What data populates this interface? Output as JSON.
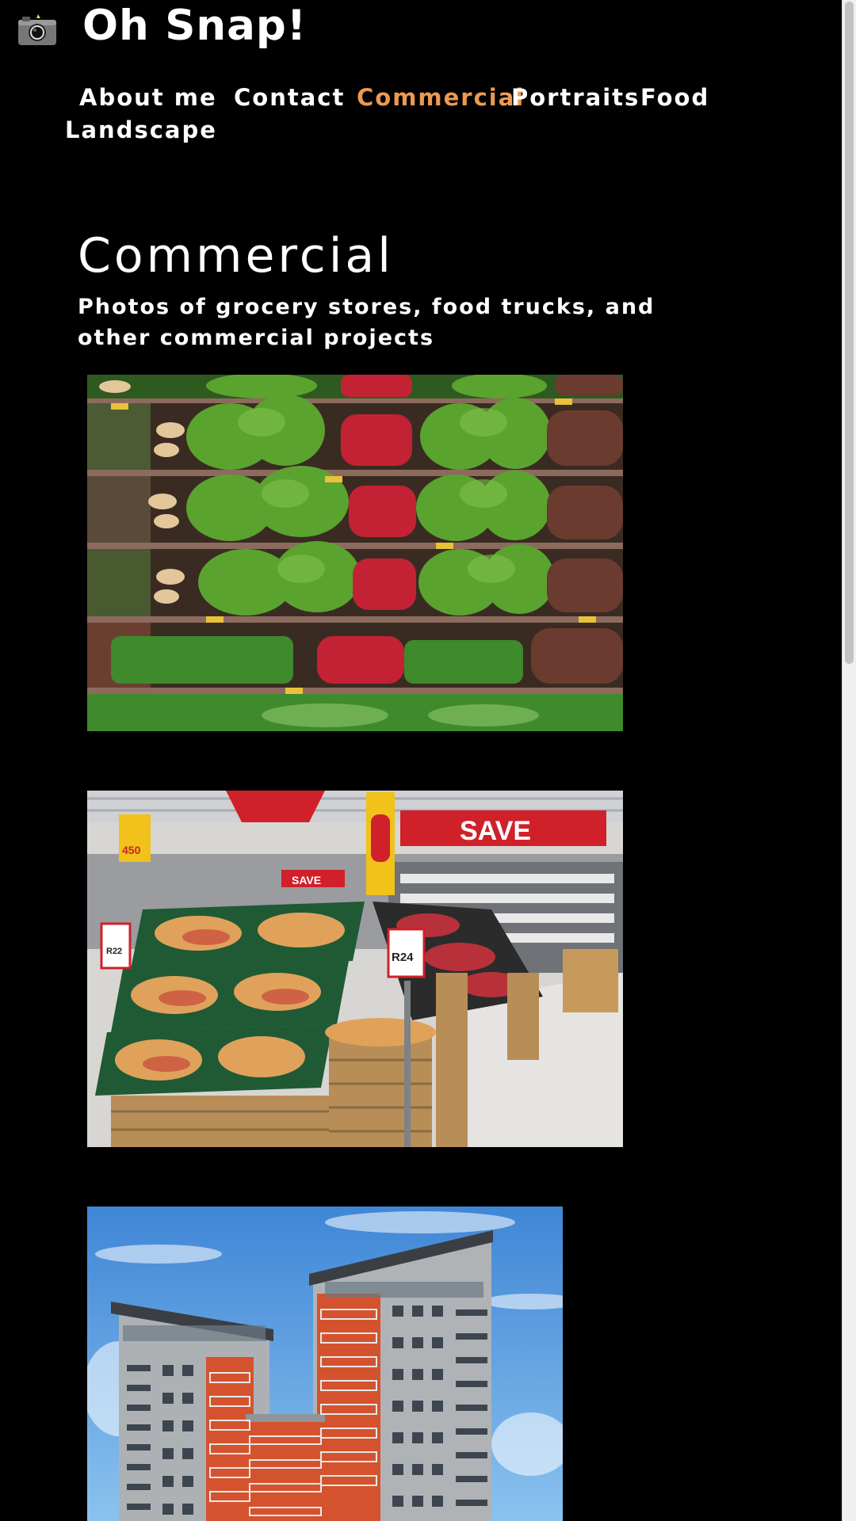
{
  "header": {
    "logo_icon": "camera-icon",
    "title": "Oh Snap!"
  },
  "nav": {
    "items": [
      {
        "label": "About me"
      },
      {
        "label": "Contact"
      },
      {
        "label": "Commercial"
      },
      {
        "label": "Portraits"
      },
      {
        "label": "Food"
      },
      {
        "label": "Landscape"
      }
    ],
    "active": "Commercial",
    "active_color": "#ec9a52"
  },
  "main": {
    "heading": "Commercial",
    "subtitle": "Photos of grocery stores, food trucks, and other commercial projects",
    "photos": [
      {
        "subject": "grocery-produce-shelves"
      },
      {
        "subject": "supermarket-fruit-displays"
      },
      {
        "subject": "apartment-buildings"
      }
    ]
  },
  "store_signs": {
    "save": "SAVE",
    "price_1": "R24",
    "price_2": "R22",
    "price_3": "450"
  }
}
